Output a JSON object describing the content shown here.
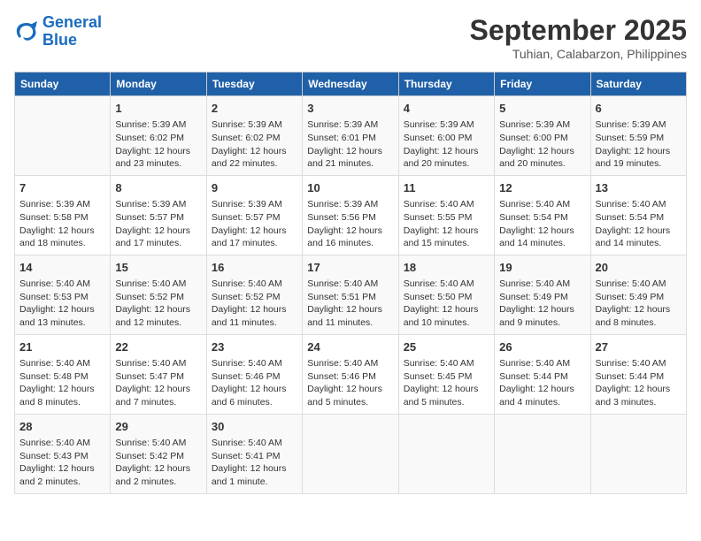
{
  "header": {
    "logo_line1": "General",
    "logo_line2": "Blue",
    "month": "September 2025",
    "location": "Tuhian, Calabarzon, Philippines"
  },
  "weekdays": [
    "Sunday",
    "Monday",
    "Tuesday",
    "Wednesday",
    "Thursday",
    "Friday",
    "Saturday"
  ],
  "weeks": [
    [
      {
        "day": "",
        "info": ""
      },
      {
        "day": "1",
        "info": "Sunrise: 5:39 AM\nSunset: 6:02 PM\nDaylight: 12 hours\nand 23 minutes."
      },
      {
        "day": "2",
        "info": "Sunrise: 5:39 AM\nSunset: 6:02 PM\nDaylight: 12 hours\nand 22 minutes."
      },
      {
        "day": "3",
        "info": "Sunrise: 5:39 AM\nSunset: 6:01 PM\nDaylight: 12 hours\nand 21 minutes."
      },
      {
        "day": "4",
        "info": "Sunrise: 5:39 AM\nSunset: 6:00 PM\nDaylight: 12 hours\nand 20 minutes."
      },
      {
        "day": "5",
        "info": "Sunrise: 5:39 AM\nSunset: 6:00 PM\nDaylight: 12 hours\nand 20 minutes."
      },
      {
        "day": "6",
        "info": "Sunrise: 5:39 AM\nSunset: 5:59 PM\nDaylight: 12 hours\nand 19 minutes."
      }
    ],
    [
      {
        "day": "7",
        "info": "Sunrise: 5:39 AM\nSunset: 5:58 PM\nDaylight: 12 hours\nand 18 minutes."
      },
      {
        "day": "8",
        "info": "Sunrise: 5:39 AM\nSunset: 5:57 PM\nDaylight: 12 hours\nand 17 minutes."
      },
      {
        "day": "9",
        "info": "Sunrise: 5:39 AM\nSunset: 5:57 PM\nDaylight: 12 hours\nand 17 minutes."
      },
      {
        "day": "10",
        "info": "Sunrise: 5:39 AM\nSunset: 5:56 PM\nDaylight: 12 hours\nand 16 minutes."
      },
      {
        "day": "11",
        "info": "Sunrise: 5:40 AM\nSunset: 5:55 PM\nDaylight: 12 hours\nand 15 minutes."
      },
      {
        "day": "12",
        "info": "Sunrise: 5:40 AM\nSunset: 5:54 PM\nDaylight: 12 hours\nand 14 minutes."
      },
      {
        "day": "13",
        "info": "Sunrise: 5:40 AM\nSunset: 5:54 PM\nDaylight: 12 hours\nand 14 minutes."
      }
    ],
    [
      {
        "day": "14",
        "info": "Sunrise: 5:40 AM\nSunset: 5:53 PM\nDaylight: 12 hours\nand 13 minutes."
      },
      {
        "day": "15",
        "info": "Sunrise: 5:40 AM\nSunset: 5:52 PM\nDaylight: 12 hours\nand 12 minutes."
      },
      {
        "day": "16",
        "info": "Sunrise: 5:40 AM\nSunset: 5:52 PM\nDaylight: 12 hours\nand 11 minutes."
      },
      {
        "day": "17",
        "info": "Sunrise: 5:40 AM\nSunset: 5:51 PM\nDaylight: 12 hours\nand 11 minutes."
      },
      {
        "day": "18",
        "info": "Sunrise: 5:40 AM\nSunset: 5:50 PM\nDaylight: 12 hours\nand 10 minutes."
      },
      {
        "day": "19",
        "info": "Sunrise: 5:40 AM\nSunset: 5:49 PM\nDaylight: 12 hours\nand 9 minutes."
      },
      {
        "day": "20",
        "info": "Sunrise: 5:40 AM\nSunset: 5:49 PM\nDaylight: 12 hours\nand 8 minutes."
      }
    ],
    [
      {
        "day": "21",
        "info": "Sunrise: 5:40 AM\nSunset: 5:48 PM\nDaylight: 12 hours\nand 8 minutes."
      },
      {
        "day": "22",
        "info": "Sunrise: 5:40 AM\nSunset: 5:47 PM\nDaylight: 12 hours\nand 7 minutes."
      },
      {
        "day": "23",
        "info": "Sunrise: 5:40 AM\nSunset: 5:46 PM\nDaylight: 12 hours\nand 6 minutes."
      },
      {
        "day": "24",
        "info": "Sunrise: 5:40 AM\nSunset: 5:46 PM\nDaylight: 12 hours\nand 5 minutes."
      },
      {
        "day": "25",
        "info": "Sunrise: 5:40 AM\nSunset: 5:45 PM\nDaylight: 12 hours\nand 5 minutes."
      },
      {
        "day": "26",
        "info": "Sunrise: 5:40 AM\nSunset: 5:44 PM\nDaylight: 12 hours\nand 4 minutes."
      },
      {
        "day": "27",
        "info": "Sunrise: 5:40 AM\nSunset: 5:44 PM\nDaylight: 12 hours\nand 3 minutes."
      }
    ],
    [
      {
        "day": "28",
        "info": "Sunrise: 5:40 AM\nSunset: 5:43 PM\nDaylight: 12 hours\nand 2 minutes."
      },
      {
        "day": "29",
        "info": "Sunrise: 5:40 AM\nSunset: 5:42 PM\nDaylight: 12 hours\nand 2 minutes."
      },
      {
        "day": "30",
        "info": "Sunrise: 5:40 AM\nSunset: 5:41 PM\nDaylight: 12 hours\nand 1 minute."
      },
      {
        "day": "",
        "info": ""
      },
      {
        "day": "",
        "info": ""
      },
      {
        "day": "",
        "info": ""
      },
      {
        "day": "",
        "info": ""
      }
    ]
  ]
}
